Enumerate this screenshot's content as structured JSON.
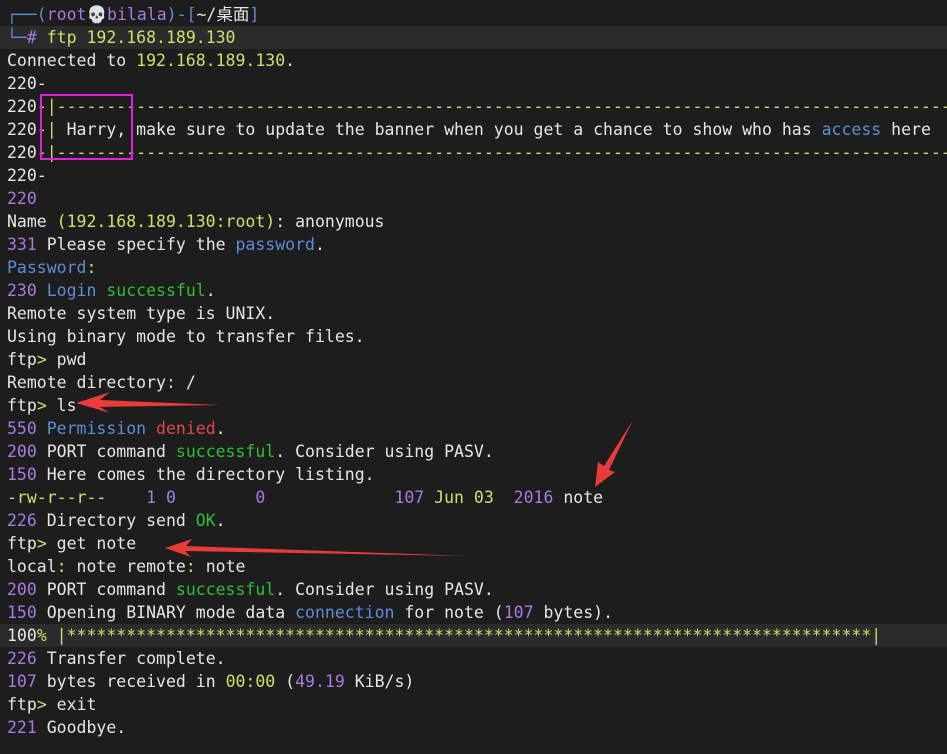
{
  "terminal": {
    "lines": [
      {
        "highlight": false,
        "segments": [
          {
            "text": "┌──(",
            "color": "blue"
          },
          {
            "text": "root",
            "color": "purple"
          },
          {
            "text": "💀",
            "color": "white"
          },
          {
            "text": "bilala",
            "color": "purple"
          },
          {
            "text": ")-[",
            "color": "blue"
          },
          {
            "text": "~/桌面",
            "color": "white"
          },
          {
            "text": "]",
            "color": "blue"
          }
        ]
      },
      {
        "highlight": true,
        "segments": [
          {
            "text": "└─",
            "color": "blue"
          },
          {
            "text": "# ",
            "color": "purple"
          },
          {
            "text": "ftp 192.168.189.130",
            "color": "yellowgreen"
          }
        ]
      },
      {
        "highlight": false,
        "segments": [
          {
            "text": "Connected to ",
            "color": "white"
          },
          {
            "text": "192.168.189.130",
            "color": "yellowgreen"
          },
          {
            "text": ".",
            "color": "white"
          }
        ]
      },
      {
        "highlight": false,
        "segments": [
          {
            "text": "220-",
            "color": "white"
          }
        ]
      },
      {
        "highlight": false,
        "segments": [
          {
            "text": "220",
            "color": "white"
          },
          {
            "text": "-|------------------------------------------------------------------------------------------",
            "color": "yellowgreen"
          }
        ]
      },
      {
        "highlight": false,
        "segments": [
          {
            "text": "220",
            "color": "white"
          },
          {
            "text": "-| ",
            "color": "yellowgreen"
          },
          {
            "text": "Harry, make sure to update the banner when you get a chance to show who has ",
            "color": "white"
          },
          {
            "text": "access",
            "color": "blue"
          },
          {
            "text": " here",
            "color": "white"
          }
        ]
      },
      {
        "highlight": false,
        "segments": [
          {
            "text": "220",
            "color": "white"
          },
          {
            "text": "-|------------------------------------------------------------------------------------------",
            "color": "yellowgreen"
          }
        ]
      },
      {
        "highlight": false,
        "segments": [
          {
            "text": "220-",
            "color": "white"
          }
        ]
      },
      {
        "highlight": false,
        "segments": [
          {
            "text": "220",
            "color": "purple"
          }
        ]
      },
      {
        "highlight": false,
        "segments": [
          {
            "text": "Name ",
            "color": "white"
          },
          {
            "text": "(192.168.189.130:root)",
            "color": "yellowgreen"
          },
          {
            "text": ": anonymous",
            "color": "white"
          }
        ]
      },
      {
        "highlight": false,
        "segments": [
          {
            "text": "331",
            "color": "purple"
          },
          {
            "text": " Please specify the ",
            "color": "white"
          },
          {
            "text": "password",
            "color": "blue"
          },
          {
            "text": ".",
            "color": "white"
          }
        ]
      },
      {
        "highlight": false,
        "segments": [
          {
            "text": "Password",
            "color": "blue"
          },
          {
            "text": ":",
            "color": "yellowgreen"
          }
        ]
      },
      {
        "highlight": false,
        "segments": [
          {
            "text": "230",
            "color": "purple"
          },
          {
            "text": " Login ",
            "color": "blue"
          },
          {
            "text": "successful",
            "color": "green"
          },
          {
            "text": ".",
            "color": "white"
          }
        ]
      },
      {
        "highlight": false,
        "segments": [
          {
            "text": "Remote system type is UNIX.",
            "color": "white"
          }
        ]
      },
      {
        "highlight": false,
        "segments": [
          {
            "text": "Using binary mode to transfer files.",
            "color": "white"
          }
        ]
      },
      {
        "highlight": false,
        "segments": [
          {
            "text": "ftp",
            "color": "white"
          },
          {
            "text": ">",
            "color": "yellowgreen"
          },
          {
            "text": " pwd",
            "color": "white"
          }
        ]
      },
      {
        "highlight": false,
        "segments": [
          {
            "text": "Remote directory",
            "color": "white"
          },
          {
            "text": ":",
            "color": "yellowgreen"
          },
          {
            "text": " /",
            "color": "white"
          }
        ]
      },
      {
        "highlight": false,
        "segments": [
          {
            "text": "ftp",
            "color": "white"
          },
          {
            "text": ">",
            "color": "yellowgreen"
          },
          {
            "text": " ls",
            "color": "white"
          }
        ]
      },
      {
        "highlight": false,
        "segments": [
          {
            "text": "550",
            "color": "purple"
          },
          {
            "text": " Permission ",
            "color": "blue"
          },
          {
            "text": "denied",
            "color": "red"
          },
          {
            "text": ".",
            "color": "white"
          }
        ]
      },
      {
        "highlight": false,
        "segments": [
          {
            "text": "200",
            "color": "purple"
          },
          {
            "text": " PORT command ",
            "color": "white"
          },
          {
            "text": "successful",
            "color": "green"
          },
          {
            "text": ". Consider using PASV.",
            "color": "white"
          }
        ]
      },
      {
        "highlight": false,
        "segments": [
          {
            "text": "150",
            "color": "purple"
          },
          {
            "text": " Here comes the directory listing.",
            "color": "white"
          }
        ]
      },
      {
        "highlight": false,
        "segments": [
          {
            "text": "-rw-r--r--",
            "color": "yellowgreen"
          },
          {
            "text": "    1 0        0             107 ",
            "color": "purple"
          },
          {
            "text": "Jun 03",
            "color": "yellowgreen"
          },
          {
            "text": "  2016",
            "color": "purple"
          },
          {
            "text": " note",
            "color": "white"
          }
        ]
      },
      {
        "highlight": false,
        "segments": [
          {
            "text": "226",
            "color": "purple"
          },
          {
            "text": " Directory send ",
            "color": "white"
          },
          {
            "text": "OK",
            "color": "green"
          },
          {
            "text": ".",
            "color": "white"
          }
        ]
      },
      {
        "highlight": false,
        "segments": [
          {
            "text": "ftp",
            "color": "white"
          },
          {
            "text": ">",
            "color": "yellowgreen"
          },
          {
            "text": " get note",
            "color": "white"
          }
        ]
      },
      {
        "highlight": false,
        "segments": [
          {
            "text": "local",
            "color": "white"
          },
          {
            "text": ":",
            "color": "yellowgreen"
          },
          {
            "text": " note remote",
            "color": "white"
          },
          {
            "text": ":",
            "color": "yellowgreen"
          },
          {
            "text": " note",
            "color": "white"
          }
        ]
      },
      {
        "highlight": false,
        "segments": [
          {
            "text": "200",
            "color": "purple"
          },
          {
            "text": " PORT command ",
            "color": "white"
          },
          {
            "text": "successful",
            "color": "green"
          },
          {
            "text": ". Consider using PASV.",
            "color": "white"
          }
        ]
      },
      {
        "highlight": false,
        "segments": [
          {
            "text": "150",
            "color": "purple"
          },
          {
            "text": " Opening BINARY mode data ",
            "color": "white"
          },
          {
            "text": "connection",
            "color": "blue"
          },
          {
            "text": " for note (",
            "color": "white"
          },
          {
            "text": "107",
            "color": "purple"
          },
          {
            "text": " bytes).",
            "color": "white"
          }
        ]
      },
      {
        "highlight": true,
        "segments": [
          {
            "text": "100",
            "color": "white"
          },
          {
            "text": "% |",
            "color": "yellowgreen"
          },
          {
            "text": "*********************************************************************************",
            "color": "yellowgreen"
          },
          {
            "text": "|",
            "color": "yellowgreen"
          }
        ]
      },
      {
        "highlight": false,
        "segments": [
          {
            "text": "226",
            "color": "purple"
          },
          {
            "text": " Transfer complete.",
            "color": "white"
          }
        ]
      },
      {
        "highlight": false,
        "segments": [
          {
            "text": "107",
            "color": "purple"
          },
          {
            "text": " bytes received in ",
            "color": "white"
          },
          {
            "text": "00:00",
            "color": "yellowgreen"
          },
          {
            "text": " (",
            "color": "white"
          },
          {
            "text": "49.19",
            "color": "purple"
          },
          {
            "text": " KiB/s)",
            "color": "white"
          }
        ]
      },
      {
        "highlight": false,
        "segments": [
          {
            "text": "ftp",
            "color": "white"
          },
          {
            "text": ">",
            "color": "yellowgreen"
          },
          {
            "text": " exit",
            "color": "white"
          }
        ]
      },
      {
        "highlight": false,
        "segments": [
          {
            "text": "221",
            "color": "purple"
          },
          {
            "text": " Goodbye.",
            "color": "white"
          }
        ]
      }
    ]
  },
  "colors": {
    "background": "#1d1d1d",
    "highlight_row": "#2b2b2b",
    "blue": "#5c8dd6",
    "purple": "#a97ae0",
    "green": "#2fbf2f",
    "yellowgreen": "#cde06a",
    "red": "#e04848",
    "white": "#e6e6e6",
    "annotation_box": "#e020e0",
    "annotation_arrow": "#ea3b3b"
  }
}
